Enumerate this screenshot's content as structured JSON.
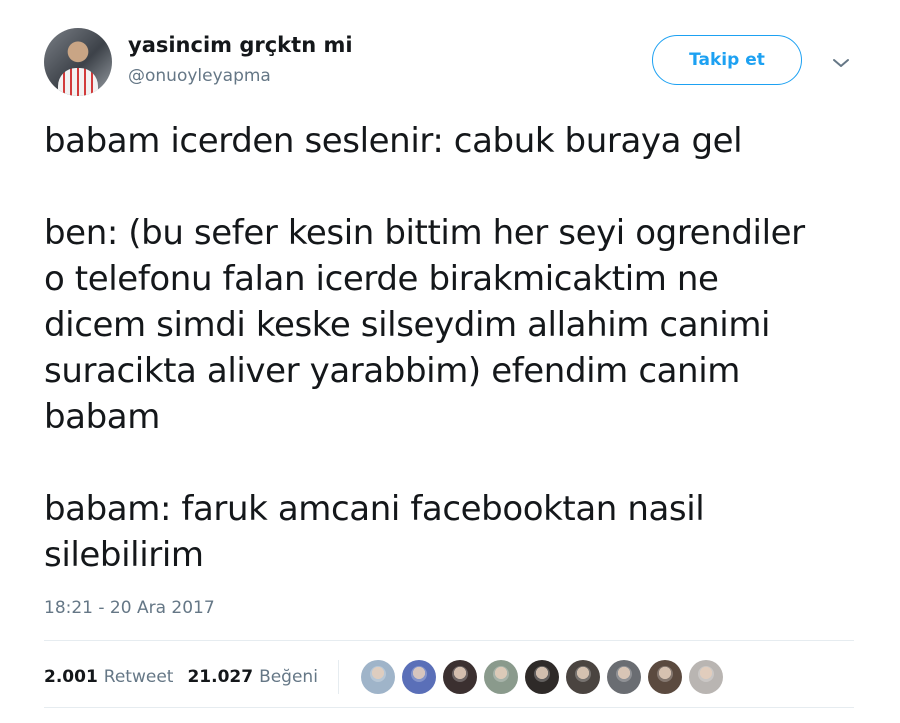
{
  "user": {
    "display_name": "yasincim grçktn mi",
    "handle": "@onuoyleyapma"
  },
  "header": {
    "follow_label": "Takip et",
    "menu_icon": "chevron-down-icon"
  },
  "tweet": {
    "paragraphs": [
      [
        "babam icerden seslenir: cabuk buraya gel"
      ],
      [
        "ben: (bu sefer kesin bittim her seyi ogrendiler",
        "o telefonu falan icerde birakmicaktim ne",
        "dicem simdi keske silseydim allahim canimi",
        "suracikta aliver yarabbim) efendim canim",
        "babam"
      ],
      [
        "babam: faruk amcani facebooktan nasil",
        "silebilirim"
      ]
    ],
    "timestamp": "18:21 - 20 Ara 2017"
  },
  "stats": {
    "retweet_count": "2.001",
    "retweet_label": "Retweet",
    "like_count": "21.027",
    "like_label": "Beğeni"
  },
  "likers": [
    {
      "icon": "avatar-1",
      "color": "#9fb4c9"
    },
    {
      "icon": "avatar-2",
      "color": "#5a6fb8"
    },
    {
      "icon": "avatar-3",
      "color": "#3b3030"
    },
    {
      "icon": "avatar-4",
      "color": "#8a9a8c"
    },
    {
      "icon": "avatar-5",
      "color": "#2e2a28"
    },
    {
      "icon": "avatar-6",
      "color": "#4a4440"
    },
    {
      "icon": "avatar-7",
      "color": "#6a6d72"
    },
    {
      "icon": "avatar-8",
      "color": "#5b4a3f"
    },
    {
      "icon": "avatar-9",
      "color": "#b9b5b2"
    }
  ],
  "colors": {
    "accent": "#1da1f2",
    "text": "#14171a",
    "muted": "#657786",
    "divider": "#e6ecf0"
  }
}
